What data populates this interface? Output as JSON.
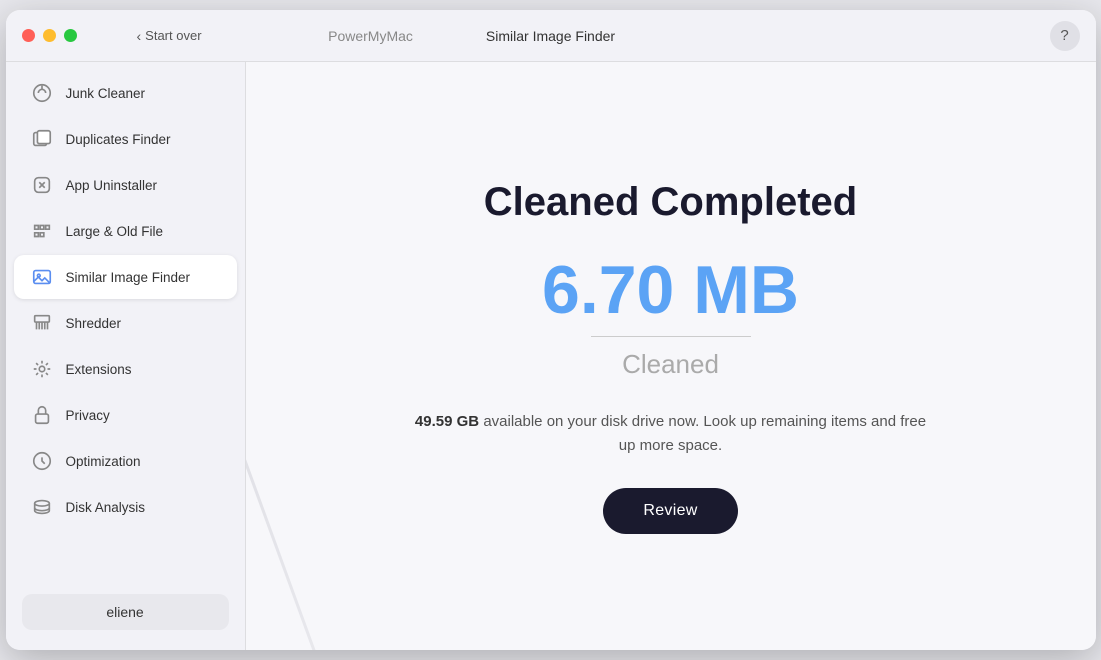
{
  "window": {
    "app_name": "PowerMyMac",
    "start_over_label": "Start over",
    "title": "Similar Image Finder",
    "help_label": "?"
  },
  "sidebar": {
    "items": [
      {
        "id": "junk-cleaner",
        "label": "Junk Cleaner",
        "active": false
      },
      {
        "id": "duplicates-finder",
        "label": "Duplicates Finder",
        "active": false
      },
      {
        "id": "app-uninstaller",
        "label": "App Uninstaller",
        "active": false
      },
      {
        "id": "large-old-file",
        "label": "Large & Old File",
        "active": false
      },
      {
        "id": "similar-image-finder",
        "label": "Similar Image Finder",
        "active": true
      },
      {
        "id": "shredder",
        "label": "Shredder",
        "active": false
      },
      {
        "id": "extensions",
        "label": "Extensions",
        "active": false
      },
      {
        "id": "privacy",
        "label": "Privacy",
        "active": false
      },
      {
        "id": "optimization",
        "label": "Optimization",
        "active": false
      },
      {
        "id": "disk-analysis",
        "label": "Disk Analysis",
        "active": false
      }
    ],
    "user_label": "eliene"
  },
  "content": {
    "completed_title": "Cleaned Completed",
    "size_value": "6.70 MB",
    "cleaned_label": "Cleaned",
    "available_gb": "49.59 GB",
    "available_text": "available on your disk drive now. Look up remaining items and free up more space.",
    "review_button_label": "Review"
  }
}
